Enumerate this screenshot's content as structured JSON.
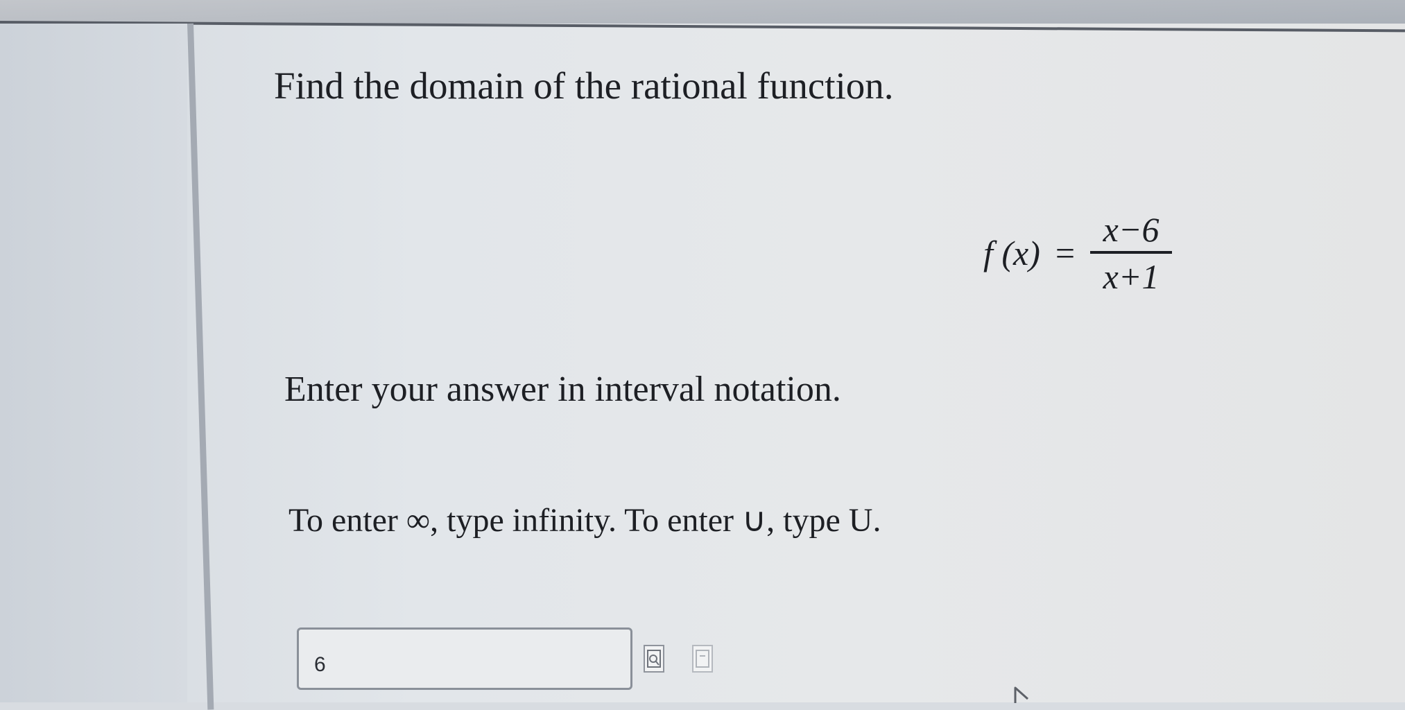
{
  "question": {
    "title": "Find the domain of the rational function.",
    "formula_lhs": "f (x)",
    "formula_eq": "=",
    "numerator": "x−6",
    "denominator": "x+1"
  },
  "instruction": "Enter your answer in interval notation.",
  "hint": "To enter ∞, type infinity. To enter ∪, type U.",
  "answer_field": {
    "value": "6"
  },
  "icons": {
    "preview": "preview-icon",
    "help": "help-icon",
    "cursor": "mouse-cursor-icon"
  }
}
